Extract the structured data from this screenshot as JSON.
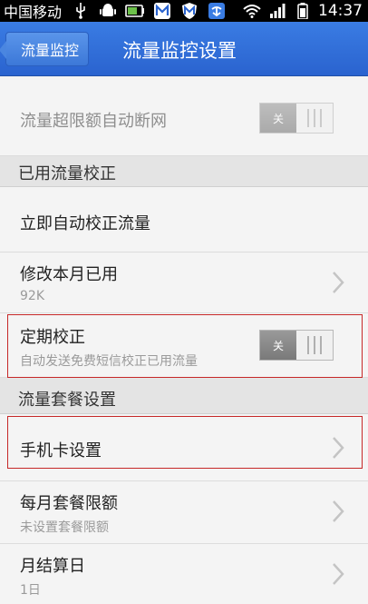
{
  "status_bar": {
    "carrier": "中国移动",
    "time": "14:37",
    "icons": [
      "usb-icon",
      "android-debug-icon",
      "battery-saver-icon",
      "app-m-icon",
      "app-m-shield-icon",
      "download-icon",
      "wifi-icon",
      "signal-icon",
      "battery-icon"
    ]
  },
  "action_bar": {
    "back_label": "流量监控",
    "title": "流量监控设置"
  },
  "settings": {
    "auto_disconnect": {
      "title": "流量超限额自动断网",
      "toggle_label": "关",
      "enabled": false
    },
    "section_calibration": "已用流量校正",
    "auto_calibrate": {
      "title": "立即自动校正流量"
    },
    "modify_used": {
      "title": "修改本月已用",
      "value": "92K"
    },
    "periodic_calibration": {
      "title": "定期校正",
      "subtitle": "自动发送免费短信校正已用流量",
      "toggle_label": "关",
      "enabled": false
    },
    "section_plan": "流量套餐设置",
    "sim_settings": {
      "title": "手机卡设置"
    },
    "monthly_limit": {
      "title": "每月套餐限额",
      "subtitle": "未设置套餐限额"
    },
    "billing_day": {
      "title": "月结算日",
      "value": "1日"
    }
  },
  "colors": {
    "action_bar": "#2f6dd9",
    "highlight_border": "#c62828"
  }
}
